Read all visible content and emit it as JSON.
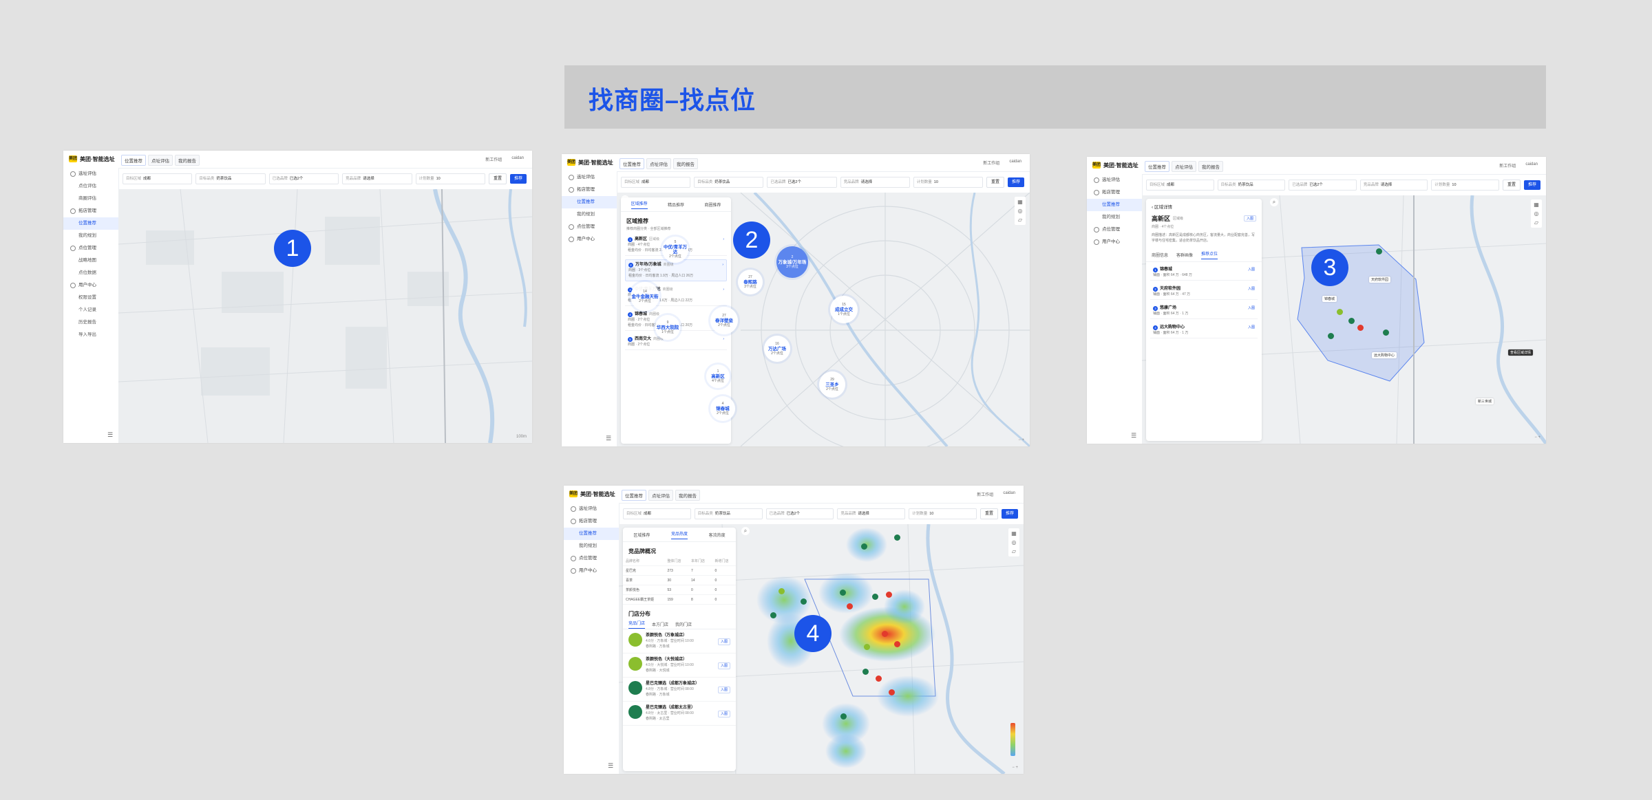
{
  "banner": {
    "title": "找商圈–找点位"
  },
  "app": {
    "logo_text": "美团",
    "title": "美团·智能选址",
    "tabs": [
      "位置推荐",
      "点址评估",
      "我的报告"
    ],
    "top_right": [
      "新工作组",
      "caidan"
    ]
  },
  "sidebar_full": [
    {
      "label": "选址评估",
      "sub": false
    },
    {
      "label": "点位评估",
      "sub": true
    },
    {
      "label": "商圈评估",
      "sub": true
    },
    {
      "label": "拓店管理",
      "sub": false
    },
    {
      "label": "位置推荐",
      "sub": true,
      "active": true
    },
    {
      "label": "我的规划",
      "sub": true
    },
    {
      "label": "点位管理",
      "sub": false
    },
    {
      "label": "战略地图",
      "sub": true
    },
    {
      "label": "点位数据",
      "sub": true
    },
    {
      "label": "用户中心",
      "sub": false
    },
    {
      "label": "权限设置",
      "sub": true
    },
    {
      "label": "个人记录",
      "sub": true
    },
    {
      "label": "历史报告",
      "sub": true
    },
    {
      "label": "导入导出",
      "sub": true
    }
  ],
  "sidebar_short": [
    {
      "label": "选址评估",
      "sub": false
    },
    {
      "label": "拓店管理",
      "sub": false
    },
    {
      "label": "位置推荐",
      "sub": true,
      "active": true
    },
    {
      "label": "我的规划",
      "sub": true
    },
    {
      "label": "点位管理",
      "sub": false
    },
    {
      "label": "用户中心",
      "sub": false
    }
  ],
  "filters": {
    "city_label": "目标区域",
    "city_value": "成都",
    "category_label": "目标品类",
    "category_value": "奶茶饮品",
    "brand_label": "已选品牌",
    "brand_value": "已选2个",
    "brand2_label": "竞品品牌",
    "brand2_value": "请选择",
    "count_label": "计划数量",
    "count_value": "10",
    "reset": "重置",
    "search": "推荐"
  },
  "screens": {
    "s1": {
      "marker": "1"
    },
    "s2": {
      "marker": "2",
      "tabs": [
        "区域推荐",
        "精品推荐",
        "商圈推荐"
      ],
      "section_title": "区域推荐",
      "section_sub": "推荐商圈分类  ·  全部区域推荐",
      "regions": [
        {
          "n": "1",
          "name": "高新区",
          "tag": "区域级",
          "line1": "商圈 · 4个点位",
          "line2": "租金均价 · 日均客流 2.3万 · 周边人口 29万"
        },
        {
          "n": "2",
          "name": "万年场/万象城",
          "tag": "商圈级",
          "line1": "商圈 · 3个点位",
          "line2": "租金均价 · 日均客流 1.9万 · 周边人口 26万"
        },
        {
          "n": "3",
          "name": "中优/青羊万达",
          "tag": "商圈级",
          "line1": "商圈 · 2个点位",
          "line2": "租金均价 · 日均客流 1.6万 · 周边人口 22万"
        },
        {
          "n": "4",
          "name": "锦春城",
          "tag": "商圈级",
          "line1": "商圈 · 2个点位",
          "line2": "租金均价 · 日均客流 1.5万 · 周边人口 20万"
        },
        {
          "n": "5",
          "name": "西南交大",
          "tag": "商圈级",
          "line1": "商圈 · 2个点位",
          "line2": ""
        }
      ],
      "clusters": [
        {
          "count": "5",
          "name": "中优/青羊万达",
          "sub": "2个点位"
        },
        {
          "count": "2",
          "name": "万象城/万年场",
          "sub": "3个点位",
          "big": true
        },
        {
          "count": "27",
          "name": "春熙路",
          "sub": "3个点位"
        },
        {
          "count": "14",
          "name": "金牛金融天街",
          "sub": "2个点位"
        },
        {
          "count": "27",
          "name": "春洋壁垒",
          "sub": "2个点位"
        },
        {
          "count": "9",
          "name": "华西大院院",
          "sub": "1个点位"
        },
        {
          "count": "16",
          "name": "万达广场",
          "sub": "2个点位"
        },
        {
          "count": "15",
          "name": "成成立交",
          "sub": "1个点位"
        },
        {
          "count": "1",
          "name": "高新区",
          "sub": "4个点位"
        },
        {
          "count": "4",
          "name": "锦春城",
          "sub": "2个点位"
        },
        {
          "count": "29",
          "name": "三圣乡",
          "sub": "2个点位"
        }
      ]
    },
    "s3": {
      "marker": "3",
      "back": "区域详情",
      "region": "高新区",
      "region_tag": "区域级",
      "enter": "入图",
      "meta": "商圈  ·  4个点位",
      "desc": "商圈描述：高新区是成都核心商务区，客流量大，商业配套完善，写字楼与住宅密集，适合奶茶饮品开店。",
      "subtabs": [
        "商圈信息",
        "客群画像",
        "推荐点位"
      ],
      "points": [
        {
          "n": "1",
          "name": "锦春城",
          "line": "铺面 · 面积 64 万 · 648 万"
        },
        {
          "n": "2",
          "name": "天府软件园",
          "line": "铺面 · 面积 64 万 · 47 万"
        },
        {
          "n": "3",
          "name": "悠康广场",
          "line": "铺面 · 面积 64 万 · 1 万"
        },
        {
          "n": "4",
          "name": "远大购物中心",
          "line": "铺面 · 面积 64 万 · 1 万"
        }
      ],
      "map_tags": [
        "天府软件园",
        "锦春城",
        "远大购物中心",
        "查看区域详情",
        "新三世城"
      ]
    },
    "s4": {
      "marker": "4",
      "tabs": [
        "区域推荐",
        "竞品热度",
        "客流热度"
      ],
      "section_title": "竞品牌概况",
      "table_head": [
        "品牌名称",
        "整体门店",
        "本年门店",
        "新增门店"
      ],
      "table_rows": [
        [
          "星巴克",
          "273",
          "7",
          "0"
        ],
        [
          "喜茶",
          "30",
          "14",
          "0"
        ],
        [
          "茶颜悦色",
          "53",
          "0",
          "0"
        ],
        [
          "CHAGEE霸王茶姬",
          "159",
          "8",
          "0"
        ]
      ],
      "stores_title": "门店分布",
      "stores_tabs": [
        "竞品门店",
        "本方门店",
        "我的门店"
      ],
      "stores": [
        {
          "name": "茶颜悦色（万象城店）",
          "line1": "4.6分 · 万象城 · 营业时间 10:00",
          "line2": "春熙路 · 万象城",
          "logo": "green-light"
        },
        {
          "name": "茶颜悦色（大悦城店）",
          "line1": "4.5分 · 大悦城 · 营业时间 10:00",
          "line2": "春熙路 · 大悦城",
          "logo": "green-light"
        },
        {
          "name": "星巴克臻选（成都万象城店）",
          "line1": "4.8分 · 万象城 · 营业时间 08:00",
          "line2": "春熙路 · 万象城",
          "logo": "starbucks"
        },
        {
          "name": "星巴克臻选（成都太古里）",
          "line1": "4.8分 · 太古里 · 营业时间 08:00",
          "line2": "春熙路 · 太古里",
          "logo": "starbucks"
        }
      ]
    }
  }
}
